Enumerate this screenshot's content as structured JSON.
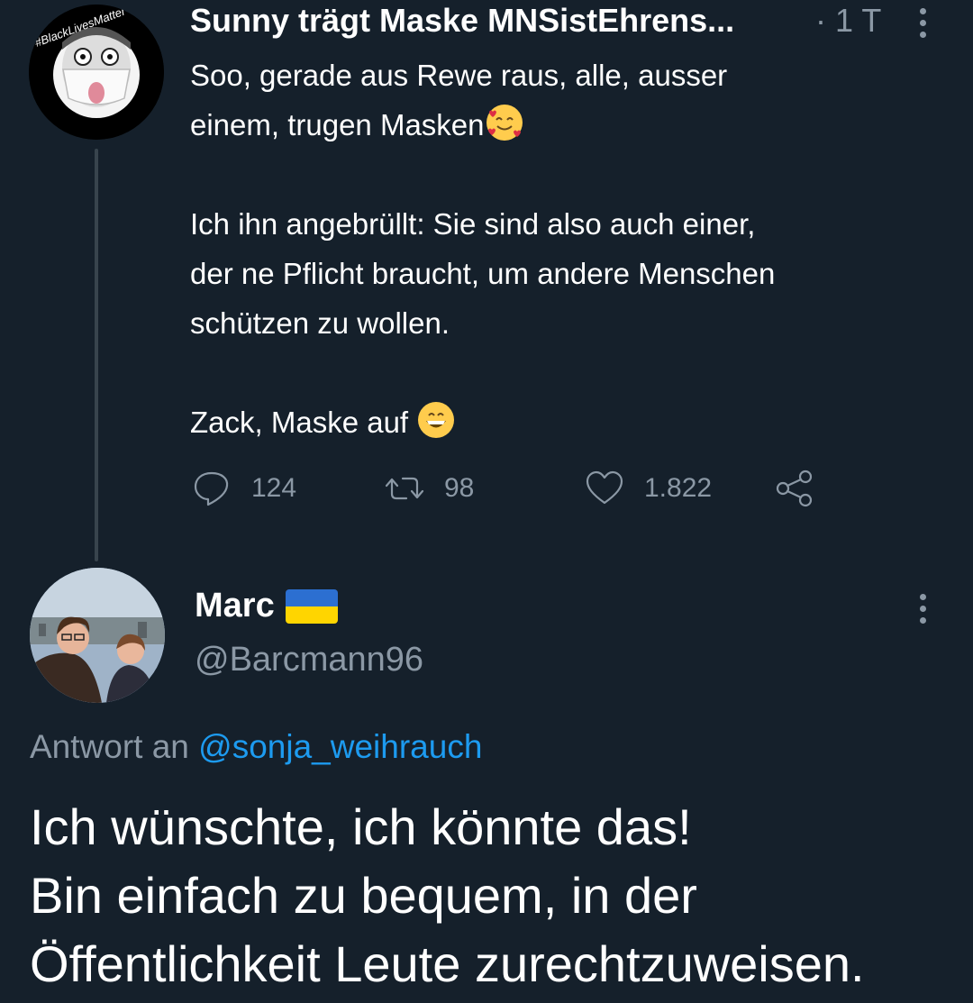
{
  "tweet1": {
    "author_name": "Sunny trägt Maske MNSistEhrens...",
    "time": "· 1 T",
    "avatar_badge": "#BlackLivesMatter",
    "text_lines": [
      "Soo, gerade aus Rewe raus, alle, ausser",
      "einem, trugen Masken",
      "",
      "Ich ihn angebrüllt: Sie sind also auch einer,",
      "der ne Pflicht braucht, um andere Menschen",
      "schützen zu wollen.",
      "",
      "Zack, Maske auf"
    ],
    "emoji_1": "smiling-face-with-hearts",
    "emoji_2": "grinning-face",
    "actions": {
      "replies": "124",
      "retweets": "98",
      "likes": "1.822"
    }
  },
  "tweet2": {
    "author_name": "Marc",
    "flag": {
      "name": "ukraine-flag",
      "top": "#2c6fd1",
      "bottom": "#ffd500"
    },
    "handle": "@Barcmann96",
    "reply_prefix": "Antwort an",
    "reply_to": "@sonja_weihrauch",
    "text_lines": [
      "Ich wünschte, ich könnte das!",
      "Bin einfach zu bequem, in der",
      "Öffentlichkeit Leute zurechtzuweisen."
    ]
  },
  "colors": {
    "background": "#15202b",
    "secondary_text": "#8b98a5",
    "link": "#1d9bf0"
  }
}
